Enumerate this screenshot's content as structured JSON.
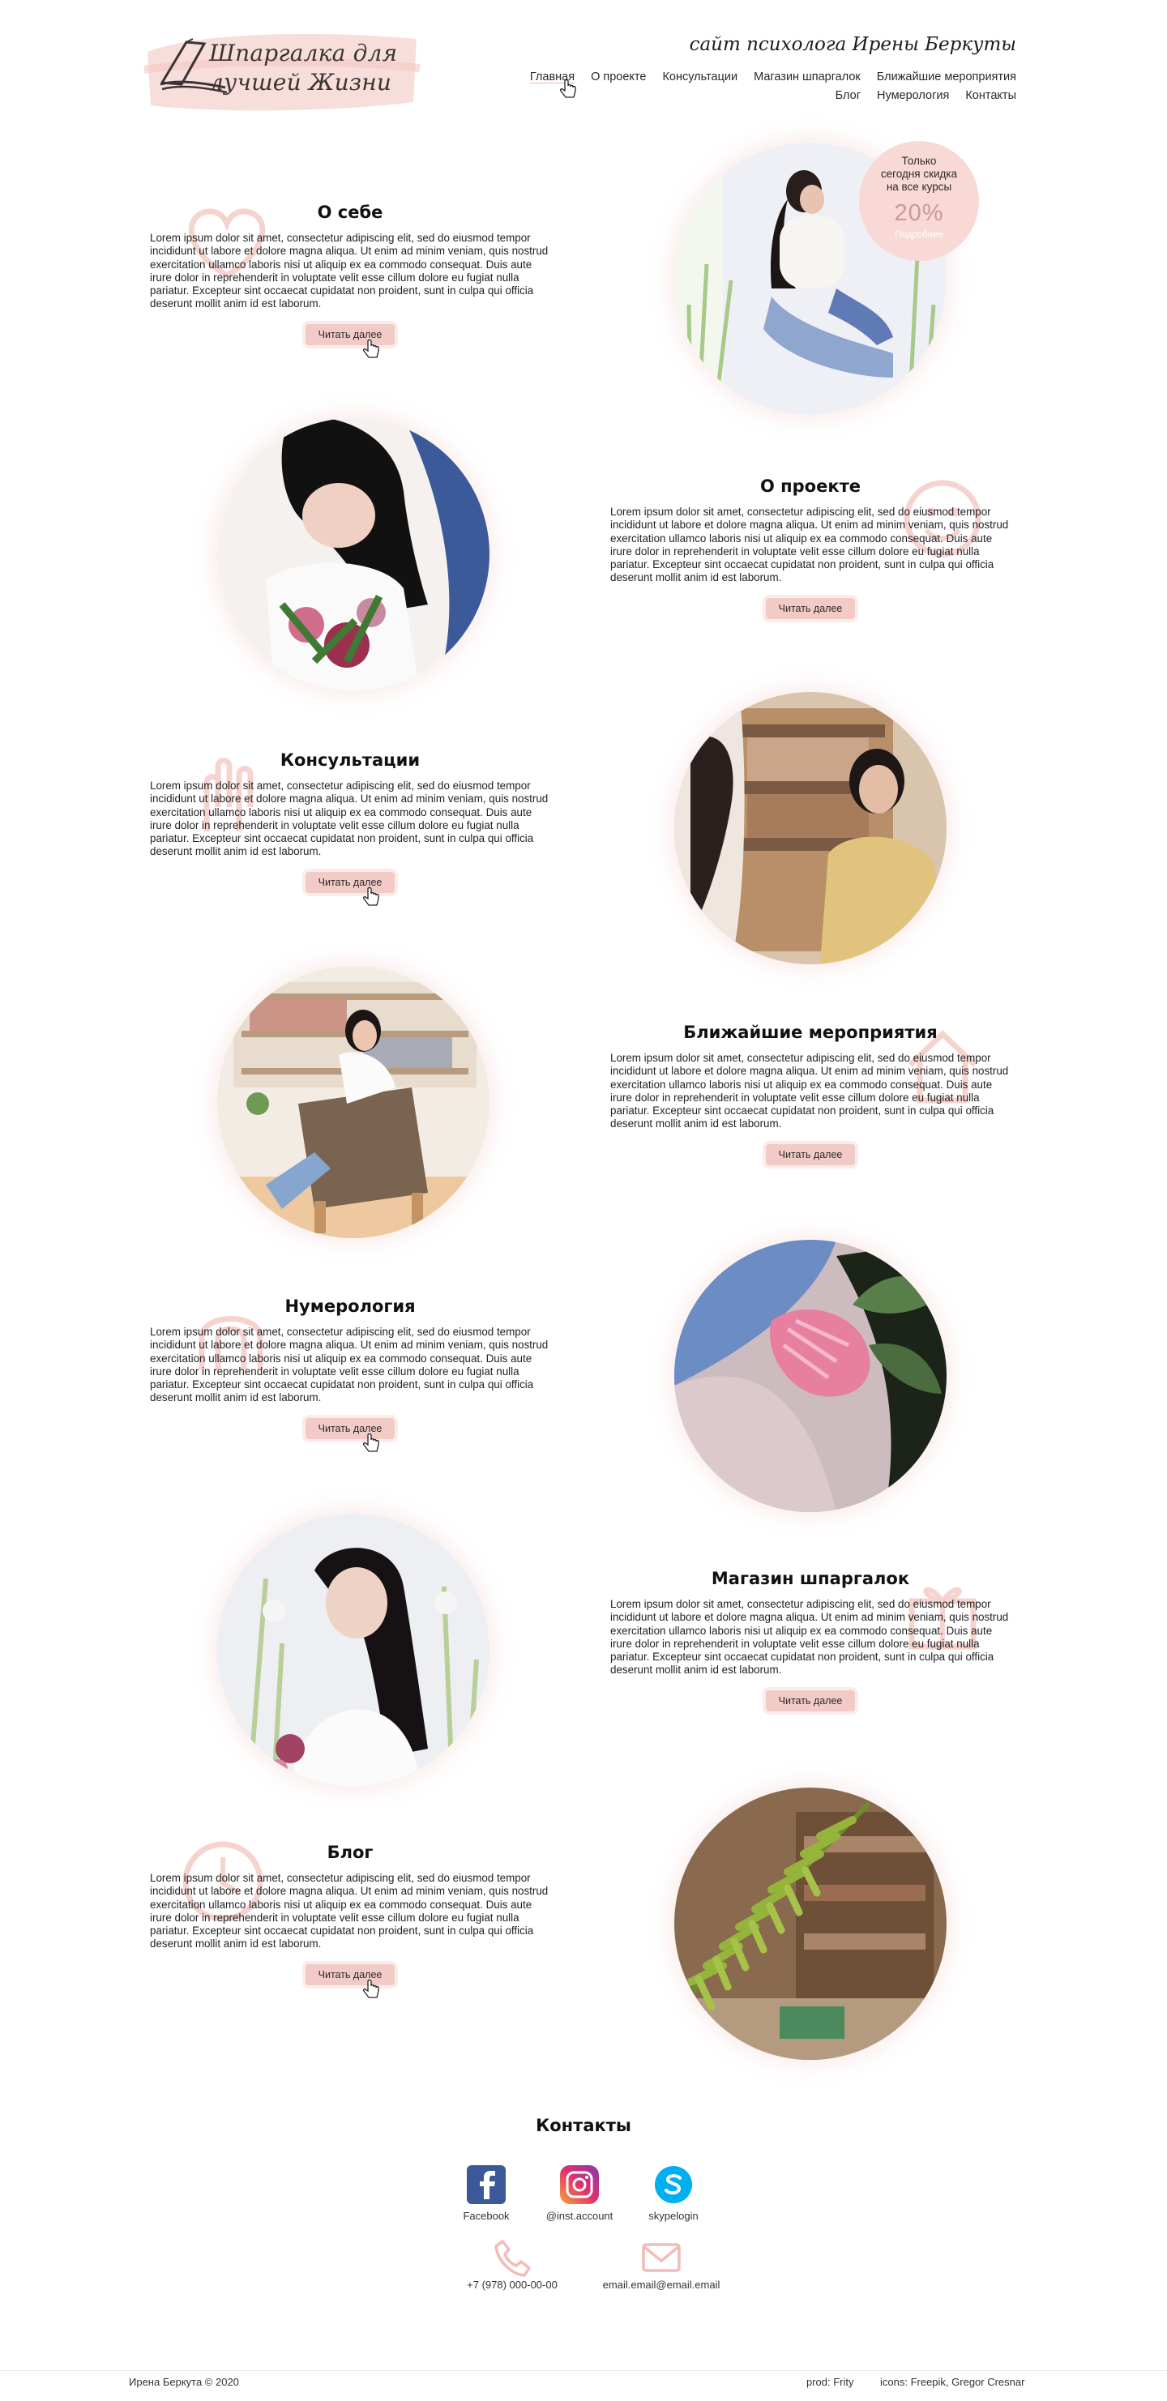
{
  "header": {
    "logo_text": "Шпаргалка для лучшей Жизни",
    "site_title": "сайт психолога Ирены Беркуты",
    "nav_row1": [
      {
        "label": "Главная",
        "active": true
      },
      {
        "label": "О проекте"
      },
      {
        "label": "Консультации"
      },
      {
        "label": "Магазин шпаргалок"
      },
      {
        "label": "Ближайшие мероприятия"
      }
    ],
    "nav_row2": [
      {
        "label": "Блог"
      },
      {
        "label": "Нумерология"
      },
      {
        "label": "Контакты"
      }
    ]
  },
  "promo": {
    "line1": "Только",
    "line2": "сегодня скидка",
    "line3": "на все курсы",
    "percent": "20%",
    "link": "Подробнее"
  },
  "lorem": "Lorem ipsum dolor sit amet, consectetur adipiscing elit, sed do eiusmod tempor incididunt ut labore et dolore magna aliqua. Ut enim ad minim veniam, quis nostrud exercitation ullamco laboris nisi ut aliquip ex ea commodo consequat. Duis aute irure dolor in reprehenderit in voluptate velit esse cillum dolore eu fugiat nulla pariatur. Excepteur sint occaecat cupidatat non proident, sunt in culpa qui officia deserunt mollit anim id est laborum.",
  "sections": [
    {
      "title": "О себе",
      "button": "Читать далее",
      "icon": "heart-icon"
    },
    {
      "title": "О проекте",
      "button": "Читать далее",
      "icon": "smile-icon"
    },
    {
      "title": "Консультации",
      "button": "Читать далее",
      "icon": "hands-icon"
    },
    {
      "title": "Ближайшие мероприятия",
      "button": "Читать далее",
      "icon": "house-icon"
    },
    {
      "title": "Нумерология",
      "button": "Читать далее",
      "icon": "magnet-icon"
    },
    {
      "title": "Магазин шпаргалок",
      "button": "Читать далее",
      "icon": "gift-icon"
    },
    {
      "title": "Блог",
      "button": "Читать далее",
      "icon": "clock-icon"
    }
  ],
  "contacts": {
    "title": "Контакты",
    "facebook": "Facebook",
    "instagram": "@inst.account",
    "skype": "skypelogin",
    "phone": "+7 (978) 000-00-00",
    "email": "email.email@email.email"
  },
  "footer": {
    "copyright": "Ирена Беркута © 2020",
    "prod": "prod: Frity",
    "icons": "icons: Freepik, Gregor Cresnar"
  },
  "colors": {
    "accent_pink": "#f2cbc6",
    "promo_bg": "#f8d9d5",
    "deco_pink": "#f6d3cf"
  }
}
